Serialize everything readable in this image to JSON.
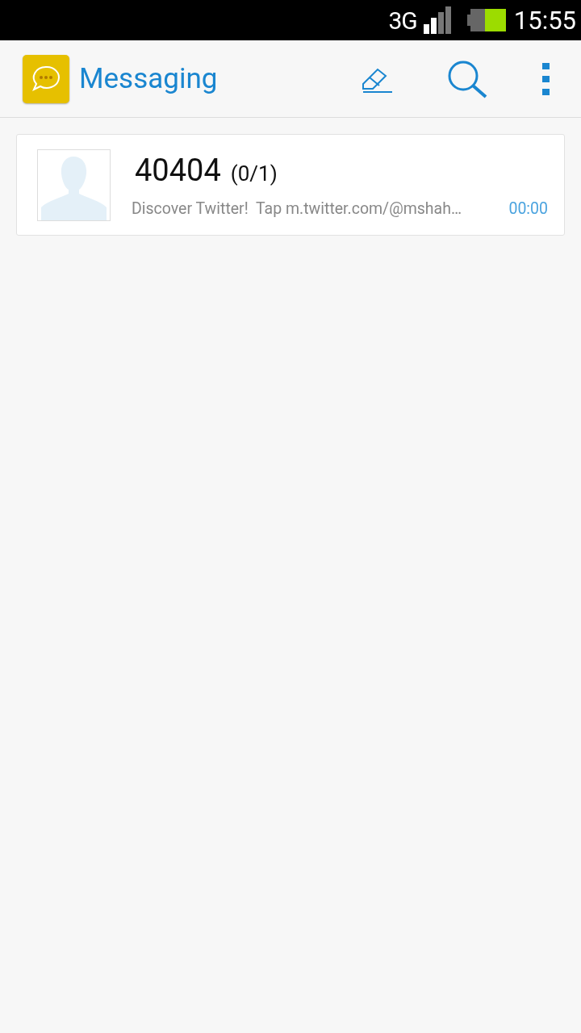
{
  "status_bar": {
    "network": "3G",
    "time": "15:55"
  },
  "app_bar": {
    "title": "Messaging"
  },
  "conversations": [
    {
      "sender": "40404",
      "count": "(0/1)",
      "preview": "Discover Twitter!  Tap m.twitter.com/@mshah…",
      "time": "00:00"
    }
  ]
}
